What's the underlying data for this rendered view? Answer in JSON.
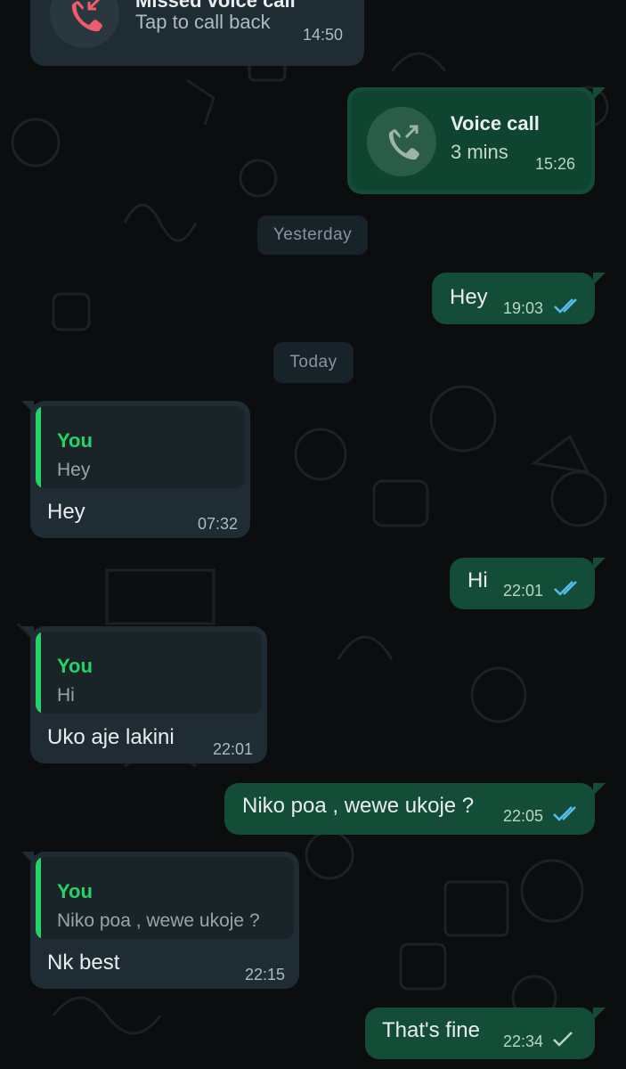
{
  "colors": {
    "incoming_bubble": "#1f2c33",
    "outgoing_bubble": "#144d37",
    "accent_green": "#25d366",
    "read_ticks": "#53bdeb",
    "missed_call_red": "#f15c6d"
  },
  "calls": {
    "missed": {
      "title": "Missed voice call",
      "subtitle": "Tap to call back",
      "time": "14:50",
      "icon": "missed-call-icon"
    },
    "voice": {
      "title": "Voice call",
      "subtitle": "3 mins",
      "time": "15:26",
      "icon": "outgoing-call-icon"
    }
  },
  "dates": {
    "yesterday": "Yesterday",
    "today": "Today"
  },
  "messages": [
    {
      "text": "Hey",
      "time": "19:03",
      "status": "read"
    },
    {
      "reply_author": "You",
      "reply_text": "Hey",
      "text": "Hey",
      "time": "07:32"
    },
    {
      "text": "Hi",
      "time": "22:01",
      "status": "read"
    },
    {
      "reply_author": "You",
      "reply_text": "Hi",
      "text": "Uko aje lakini",
      "time": "22:01"
    },
    {
      "text": "Niko poa , wewe ukoje ?",
      "time": "22:05",
      "status": "read"
    },
    {
      "reply_author": "You",
      "reply_text": "Niko poa , wewe ukoje ?",
      "text": "Nk best",
      "time": "22:15"
    },
    {
      "text": "That's fine",
      "time": "22:34",
      "status": "sent"
    }
  ]
}
